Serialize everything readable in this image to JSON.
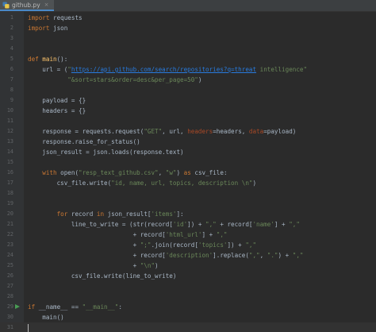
{
  "tab": {
    "label": "github.py",
    "icon": "python-file-icon",
    "close_glyph": "×"
  },
  "colors": {
    "background": "#2b2b2b",
    "gutter": "#313335",
    "keyword": "#cc7832",
    "function": "#ffc66d",
    "string": "#6a8759",
    "url": "#287bde",
    "param": "#aa4926",
    "dunder": "#b200b2",
    "text": "#a9b7c6",
    "line_number": "#606366",
    "run_icon": "#499c54"
  },
  "editor": {
    "lines": [
      {
        "num": "1",
        "tokens": [
          {
            "c": "kw",
            "t": "import"
          },
          {
            "c": "plain",
            "t": " requests"
          }
        ]
      },
      {
        "num": "2",
        "tokens": [
          {
            "c": "kw",
            "t": "import"
          },
          {
            "c": "plain",
            "t": " json"
          }
        ]
      },
      {
        "num": "3",
        "tokens": []
      },
      {
        "num": "4",
        "tokens": []
      },
      {
        "num": "5",
        "tokens": [
          {
            "c": "kw",
            "t": "def "
          },
          {
            "c": "fn",
            "t": "main"
          },
          {
            "c": "plain",
            "t": "():"
          }
        ]
      },
      {
        "num": "6",
        "tokens": [
          {
            "c": "plain",
            "t": "    url = ("
          },
          {
            "c": "str",
            "t": "\""
          },
          {
            "c": "url",
            "t": "https://api.github.com/search/repositories?q=threat"
          },
          {
            "c": "str",
            "t": " intelligence\""
          }
        ]
      },
      {
        "num": "7",
        "tokens": [
          {
            "c": "str",
            "t": "           \"&sort=stars&order=desc&per_page=50\""
          },
          {
            "c": "plain",
            "t": ")"
          }
        ]
      },
      {
        "num": "8",
        "tokens": []
      },
      {
        "num": "9",
        "tokens": [
          {
            "c": "plain",
            "t": "    payload = {}"
          }
        ]
      },
      {
        "num": "10",
        "tokens": [
          {
            "c": "plain",
            "t": "    headers = {}"
          }
        ]
      },
      {
        "num": "11",
        "tokens": []
      },
      {
        "num": "12",
        "tokens": [
          {
            "c": "plain",
            "t": "    response = requests.request("
          },
          {
            "c": "str",
            "t": "\"GET\""
          },
          {
            "c": "plain",
            "t": ", url, "
          },
          {
            "c": "param",
            "t": "headers"
          },
          {
            "c": "plain",
            "t": "=headers, "
          },
          {
            "c": "param",
            "t": "data"
          },
          {
            "c": "plain",
            "t": "=payload)"
          }
        ]
      },
      {
        "num": "13",
        "tokens": [
          {
            "c": "plain",
            "t": "    response.raise_for_status()"
          }
        ]
      },
      {
        "num": "14",
        "tokens": [
          {
            "c": "plain",
            "t": "    json_result = json.loads(response.text)"
          }
        ]
      },
      {
        "num": "15",
        "tokens": []
      },
      {
        "num": "16",
        "tokens": [
          {
            "c": "kw",
            "t": "    with "
          },
          {
            "c": "plain",
            "t": "open("
          },
          {
            "c": "str",
            "t": "\"resp_text_github.csv\""
          },
          {
            "c": "plain",
            "t": ", "
          },
          {
            "c": "str",
            "t": "\"w\""
          },
          {
            "c": "plain",
            "t": ") "
          },
          {
            "c": "kw",
            "t": "as"
          },
          {
            "c": "plain",
            "t": " csv_file:"
          }
        ]
      },
      {
        "num": "17",
        "tokens": [
          {
            "c": "plain",
            "t": "        csv_file.write("
          },
          {
            "c": "str",
            "t": "\"id, name, url, topics, description \\n\""
          },
          {
            "c": "plain",
            "t": ")"
          }
        ]
      },
      {
        "num": "18",
        "tokens": []
      },
      {
        "num": "19",
        "tokens": []
      },
      {
        "num": "20",
        "tokens": [
          {
            "c": "kw",
            "t": "        for"
          },
          {
            "c": "plain",
            "t": " record "
          },
          {
            "c": "kw",
            "t": "in"
          },
          {
            "c": "plain",
            "t": " json_result["
          },
          {
            "c": "str",
            "t": "'items'"
          },
          {
            "c": "plain",
            "t": "]:"
          }
        ]
      },
      {
        "num": "21",
        "tokens": [
          {
            "c": "plain",
            "t": "            line_to_write = (str(record["
          },
          {
            "c": "str",
            "t": "'id'"
          },
          {
            "c": "plain",
            "t": "]) + "
          },
          {
            "c": "str",
            "t": "\",\""
          },
          {
            "c": "plain",
            "t": " + record["
          },
          {
            "c": "str",
            "t": "'name'"
          },
          {
            "c": "plain",
            "t": "] + "
          },
          {
            "c": "str",
            "t": "\",\""
          }
        ]
      },
      {
        "num": "22",
        "tokens": [
          {
            "c": "plain",
            "t": "                             + record["
          },
          {
            "c": "str",
            "t": "'html_url'"
          },
          {
            "c": "plain",
            "t": "] + "
          },
          {
            "c": "str",
            "t": "\",\""
          }
        ]
      },
      {
        "num": "23",
        "tokens": [
          {
            "c": "plain",
            "t": "                             + "
          },
          {
            "c": "str",
            "t": "\";\""
          },
          {
            "c": "plain",
            "t": ".join(record["
          },
          {
            "c": "str",
            "t": "'topics'"
          },
          {
            "c": "plain",
            "t": "]) + "
          },
          {
            "c": "str",
            "t": "\",\""
          }
        ]
      },
      {
        "num": "24",
        "tokens": [
          {
            "c": "plain",
            "t": "                             + record["
          },
          {
            "c": "str",
            "t": "'description'"
          },
          {
            "c": "plain",
            "t": "].replace("
          },
          {
            "c": "str",
            "t": "\",\""
          },
          {
            "c": "plain",
            "t": ", "
          },
          {
            "c": "str",
            "t": "\".\""
          },
          {
            "c": "plain",
            "t": ") + "
          },
          {
            "c": "str",
            "t": "\",\""
          }
        ]
      },
      {
        "num": "25",
        "tokens": [
          {
            "c": "plain",
            "t": "                             + "
          },
          {
            "c": "str",
            "t": "\"\\n\""
          },
          {
            "c": "plain",
            "t": ")"
          }
        ]
      },
      {
        "num": "26",
        "tokens": [
          {
            "c": "plain",
            "t": "            csv_file.write(line_to_write)"
          }
        ]
      },
      {
        "num": "27",
        "tokens": []
      },
      {
        "num": "28",
        "tokens": []
      },
      {
        "num": "29",
        "tokens": [
          {
            "c": "kw",
            "t": "if"
          },
          {
            "c": "plain",
            "t": " __name__ == "
          },
          {
            "c": "str",
            "t": "\"__main__\""
          },
          {
            "c": "plain",
            "t": ":"
          }
        ],
        "run": true
      },
      {
        "num": "30",
        "tokens": [
          {
            "c": "plain",
            "t": "    main()"
          }
        ]
      },
      {
        "num": "31",
        "tokens": [],
        "cursor": true
      }
    ]
  }
}
